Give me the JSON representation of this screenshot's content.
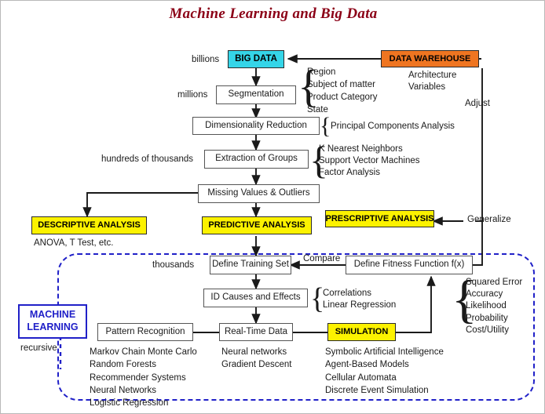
{
  "title": "Machine Learning and Big Data",
  "watermark": "",
  "colors": {
    "title": "#8B0016",
    "big_data": "#35D5E8",
    "data_warehouse": "#EF7521",
    "analysis": "#FCF200",
    "machine_learning": "#2020C8",
    "frame": "#2020C8"
  },
  "scale_labels": {
    "billions": "billions",
    "millions": "millions",
    "hundreds_of_thousands": "hundreds of thousands",
    "thousands": "thousands",
    "recursive": "recursive"
  },
  "nodes": {
    "big_data": "BIG DATA",
    "data_warehouse": "DATA WAREHOUSE",
    "segmentation": "Segmentation",
    "dimensionality_reduction": "Dimensionality Reduction",
    "extraction_of_groups": "Extraction of Groups",
    "missing_values": "Missing Values & Outliers",
    "descriptive_analysis": "DESCRIPTIVE ANALYSIS",
    "predictive_analysis": "PREDICTIVE ANALYSIS",
    "prescriptive_analysis": "PRESCRIPTIVE ANALYSIS",
    "define_training_set": "Define Training Set",
    "define_fitness_function": "Define Fitness Function f(x)",
    "id_causes_effects": "ID Causes and Effects",
    "pattern_recognition": "Pattern Recognition",
    "real_time_data": "Real-Time Data",
    "simulation": "SIMULATION",
    "machine_learning_line1": "MACHINE",
    "machine_learning_line2": "LEARNING"
  },
  "edge_labels": {
    "adjust": "Adjust",
    "generalize": "Generalize",
    "compare": "Compare"
  },
  "annotations": {
    "data_warehouse_items": [
      "Architecture",
      "Variables"
    ],
    "segmentation_items": [
      "Region",
      "Subject of matter",
      "Product Category",
      "State"
    ],
    "dimensionality_items": [
      "Principal Components Analysis"
    ],
    "extraction_items": [
      "K Nearest Neighbors",
      "Support Vector Machines",
      "Factor Analysis"
    ],
    "descriptive_items": [
      "ANOVA, T Test, etc."
    ],
    "id_causes_items": [
      "Correlations",
      "Linear Regression"
    ],
    "fitness_items": [
      "Squared Error",
      "Accuracy",
      "Likelihood",
      "Probability",
      "Cost/Utility"
    ],
    "pattern_recognition_items": [
      "Markov Chain Monte Carlo",
      "Random Forests",
      "Recommender Systems",
      "Neural Networks",
      "Logistic Regression"
    ],
    "real_time_items": [
      "Neural networks",
      "Gradient Descent"
    ],
    "simulation_items": [
      "Symbolic Artificial Intelligence",
      "Agent-Based Models",
      "Cellular Automata",
      "Discrete Event Simulation"
    ]
  }
}
